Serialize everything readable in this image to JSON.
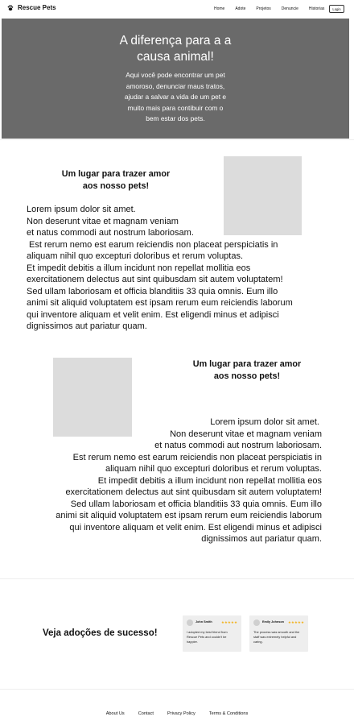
{
  "nav": {
    "brand": "Rescue Pets",
    "links": [
      "Home",
      "Adote",
      "Projetos",
      "Denuncie",
      "Historias"
    ],
    "login": "Login"
  },
  "hero": {
    "title_lines": [
      "A diferença para a a",
      "causa animal!"
    ],
    "text_lines": [
      "Aqui você pode encontrar um pet",
      "amoroso, denunciar maus tratos,",
      "ajudar a salvar a vida de um pet e",
      "muito mais para contibuir com o",
      "bem estar dos pets."
    ]
  },
  "section1": {
    "title_lines": [
      "Um lugar para trazer amor",
      "aos nosso pets!"
    ],
    "body_lines": [
      "Lorem ipsum dolor sit amet.",
      "Non deserunt vitae et magnam veniam",
      "et natus commodi aut nostrum laboriosam.",
      " Est rerum nemo est earum reiciendis non placeat perspiciatis in",
      "aliquam nihil quo excepturi doloribus et rerum voluptas.",
      "Et impedit debitis a illum incidunt non repellat mollitia eos",
      "exercitationem delectus aut sint quibusdam sit autem voluptatem!",
      "Sed ullam laboriosam et officia blanditiis 33 quia omnis. Eum illo",
      "animi sit aliquid voluptatem est ipsam rerum eum reiciendis laborum",
      "qui inventore aliquam et velit enim. Est eligendi minus et adipisci",
      "dignissimos aut pariatur quam."
    ]
  },
  "section2": {
    "title_lines": [
      "Um lugar para trazer amor",
      "aos nosso pets!"
    ],
    "body_lines": [
      "Lorem ipsum dolor sit amet. ",
      "Non deserunt vitae et magnam veniam",
      "et natus commodi aut nostrum laboriosam.",
      "Est rerum nemo est earum reiciendis non placeat perspiciatis in",
      "aliquam nihil quo excepturi doloribus et rerum voluptas.",
      "Et impedit debitis a illum incidunt non repellat mollitia eos",
      "exercitationem delectus aut sint quibusdam sit autem voluptatem!",
      "Sed ullam laboriosam et officia blanditiis 33 quia omnis. Eum illo",
      "animi sit aliquid voluptatem est ipsam rerum eum reiciendis laborum",
      "qui inventore aliquam et velit enim. Est eligendi minus et adipisci",
      "dignissimos aut pariatur quam."
    ]
  },
  "testimonials": {
    "title": "Veja adoções de sucesso!",
    "cards": [
      {
        "name": "John Smith",
        "stars": "★★★★★",
        "text": "I adopted my best friend from Rescue Pets and couldn't be happier."
      },
      {
        "name": "Emily Johnson",
        "stars": "★★★★★",
        "text": "The process was smooth and the staff was extremely helpful and caring."
      }
    ]
  },
  "footer": {
    "links": [
      "About Us",
      "Contact",
      "Privacy Policy",
      "Terms & Conditions"
    ]
  },
  "colors": {
    "hero_bg": "#6a6a6a",
    "placeholder": "#dcdcdc",
    "card_bg": "#eeeeee",
    "stars": "#f2b21c"
  }
}
